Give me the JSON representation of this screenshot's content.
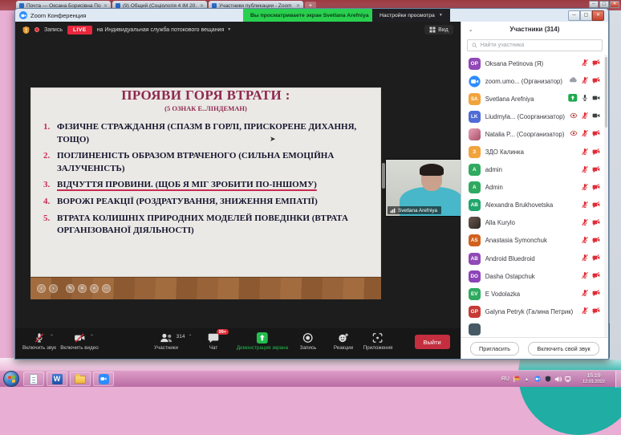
{
  "browser": {
    "tabs": [
      {
        "title": "Почта — Оксана Борисівна По…"
      },
      {
        "title": "(9) Общий (Соціологія 4 ІМ 20…"
      },
      {
        "title": "Участники публикации - Zoom"
      }
    ],
    "new_tab_label": "+"
  },
  "window": {
    "title": "Zoom Конференция",
    "banner": "Вы просматриваете экран Svetlana Arefniya",
    "view_settings_label": "Настройки просмотра"
  },
  "meeting_header": {
    "record_label": "Запись",
    "live_label": "LIVE",
    "stream_label": "на Индивидуальная служба потокового вещания",
    "view_label": "Вид"
  },
  "slide": {
    "title": "ПРОЯВИ ГОРЯ ВТРАТИ :",
    "subtitle": "(5 ОЗНАК Е..ЛІНДЕМАН)",
    "items": [
      {
        "text": "ФІЗИЧНЕ СТРАЖДАННЯ (СПАЗМ В ГОРЛІ, ПРИСКОРЕНЕ ДИХАННЯ, ТОЩО)",
        "underline": false
      },
      {
        "text": "ПОГЛИНЕНІСТЬ ОБРАЗОМ ВТРАЧЕНОГО (СИЛЬНА ЕМОЦІЙНА ЗАЛУЧЕНІСТЬ)",
        "underline": false
      },
      {
        "text": "ВІДЧУТТЯ ПРОВИНИ. (ЩОБ Я МІГ ЗРОБИТИ ПО-ІНШОМУ)",
        "underline": true
      },
      {
        "text": "ВОРОЖІ РЕАКЦІЇ (РОЗДРАТУВАННЯ, ЗНИЖЕННЯ ЕМПАТІЇ)",
        "underline": false
      },
      {
        "text": "ВТРАТА КОЛИШНІХ ПРИРОДНИХ МОДЕЛЕЙ ПОВЕДІНКИ (ВТРАТА ОРГАНІЗОВАНОЇ ДІЯЛЬНОСТІ)",
        "underline": false
      }
    ],
    "controls": [
      "‹",
      "›",
      "✎",
      "⌗",
      "⌕",
      "⋯"
    ]
  },
  "speaker_tile": {
    "name": "Svetlana Arefniya"
  },
  "toolbar": {
    "buttons": [
      {
        "label": "Включить звук",
        "icon": "mic-muted",
        "caret": true
      },
      {
        "label": "Включить видео",
        "icon": "cam-muted",
        "caret": true
      },
      {
        "label": "Участники",
        "icon": "people",
        "count": "314",
        "caret": true
      },
      {
        "label": "Чат",
        "icon": "chat",
        "badge": "99+"
      },
      {
        "label": "Демонстрация экрана",
        "icon": "share-screen",
        "green": true
      },
      {
        "label": "Запись",
        "icon": "record"
      },
      {
        "label": "Реакции",
        "icon": "reactions"
      },
      {
        "label": "Приложения",
        "icon": "apps"
      }
    ],
    "leave_label": "Выйти"
  },
  "participants_panel": {
    "title": "Участники (314)",
    "search_placeholder": "Найти участника",
    "participants": [
      {
        "initials": "OP",
        "color": "#9149b6",
        "name": "Oksana Petinova (Я)",
        "mic": "muted",
        "video": "off"
      },
      {
        "avatar": "zoom-logo",
        "name": "zoom.umo...  (Организатор)",
        "badges": [
          "cloud"
        ],
        "mic": "muted",
        "video": "off"
      },
      {
        "initials": "SA",
        "color": "#f2a33c",
        "name": "Svetlana Arefniya",
        "badges": [
          "share"
        ],
        "mic": "on",
        "video": "on"
      },
      {
        "initials": "LK",
        "color": "#4f6bd5",
        "name": "Liudmyla...  (Соорганизатор)",
        "badges": [
          "eye"
        ],
        "mic": "muted",
        "video": "on"
      },
      {
        "photo": "photo-pink",
        "name": "Natalia P...  (Соорганизатор)",
        "badges": [
          "eye"
        ],
        "mic": "muted",
        "video": "off"
      },
      {
        "initials": "З",
        "color": "#f2a33c",
        "name": "ЗДО Калинка",
        "mic": "muted",
        "video": "off"
      },
      {
        "initials": "A",
        "color": "#2faa60",
        "name": "admin",
        "mic": "muted",
        "video": "off"
      },
      {
        "initials": "A",
        "color": "#2faa60",
        "name": "Admin",
        "mic": "muted",
        "video": "off"
      },
      {
        "initials": "AB",
        "color": "#21a66d",
        "name": "Alexandra Brukhovetska",
        "mic": "muted",
        "video": "off"
      },
      {
        "photo": "photo-dark",
        "name": "Alla Kurylo",
        "mic": "muted",
        "video": "off"
      },
      {
        "initials": "AS",
        "color": "#d2611e",
        "name": "Anastasia Symonchuk",
        "mic": "muted",
        "video": "off"
      },
      {
        "initials": "AB",
        "color": "#9149b6",
        "name": "Android Bluedroid",
        "mic": "muted",
        "video": "off"
      },
      {
        "initials": "DO",
        "color": "#8d44b8",
        "name": "Dasha Ostapchuk",
        "mic": "muted",
        "video": "off"
      },
      {
        "initials": "EV",
        "color": "#2faa60",
        "name": "E Vodolazka",
        "mic": "muted",
        "video": "off"
      },
      {
        "initials": "GP",
        "color": "#c63b35",
        "name": "Galyna Petryk (Галина Петрик)",
        "mic": "muted",
        "video": "off"
      },
      {
        "initials": "",
        "color": "#455a64",
        "name": "",
        "partial": true
      }
    ],
    "invite_label": "Пригласить",
    "unmute_label": "Включить свой звук"
  },
  "desktop": {
    "lang": "RU",
    "time": "15:19",
    "date": "12.01.2022"
  },
  "colors": {
    "live_red": "#e8273c",
    "banner_green": "#29cf4e",
    "share_green": "#23bd4e",
    "leave_red": "#c52e3e",
    "muted_red": "#e02b35"
  }
}
